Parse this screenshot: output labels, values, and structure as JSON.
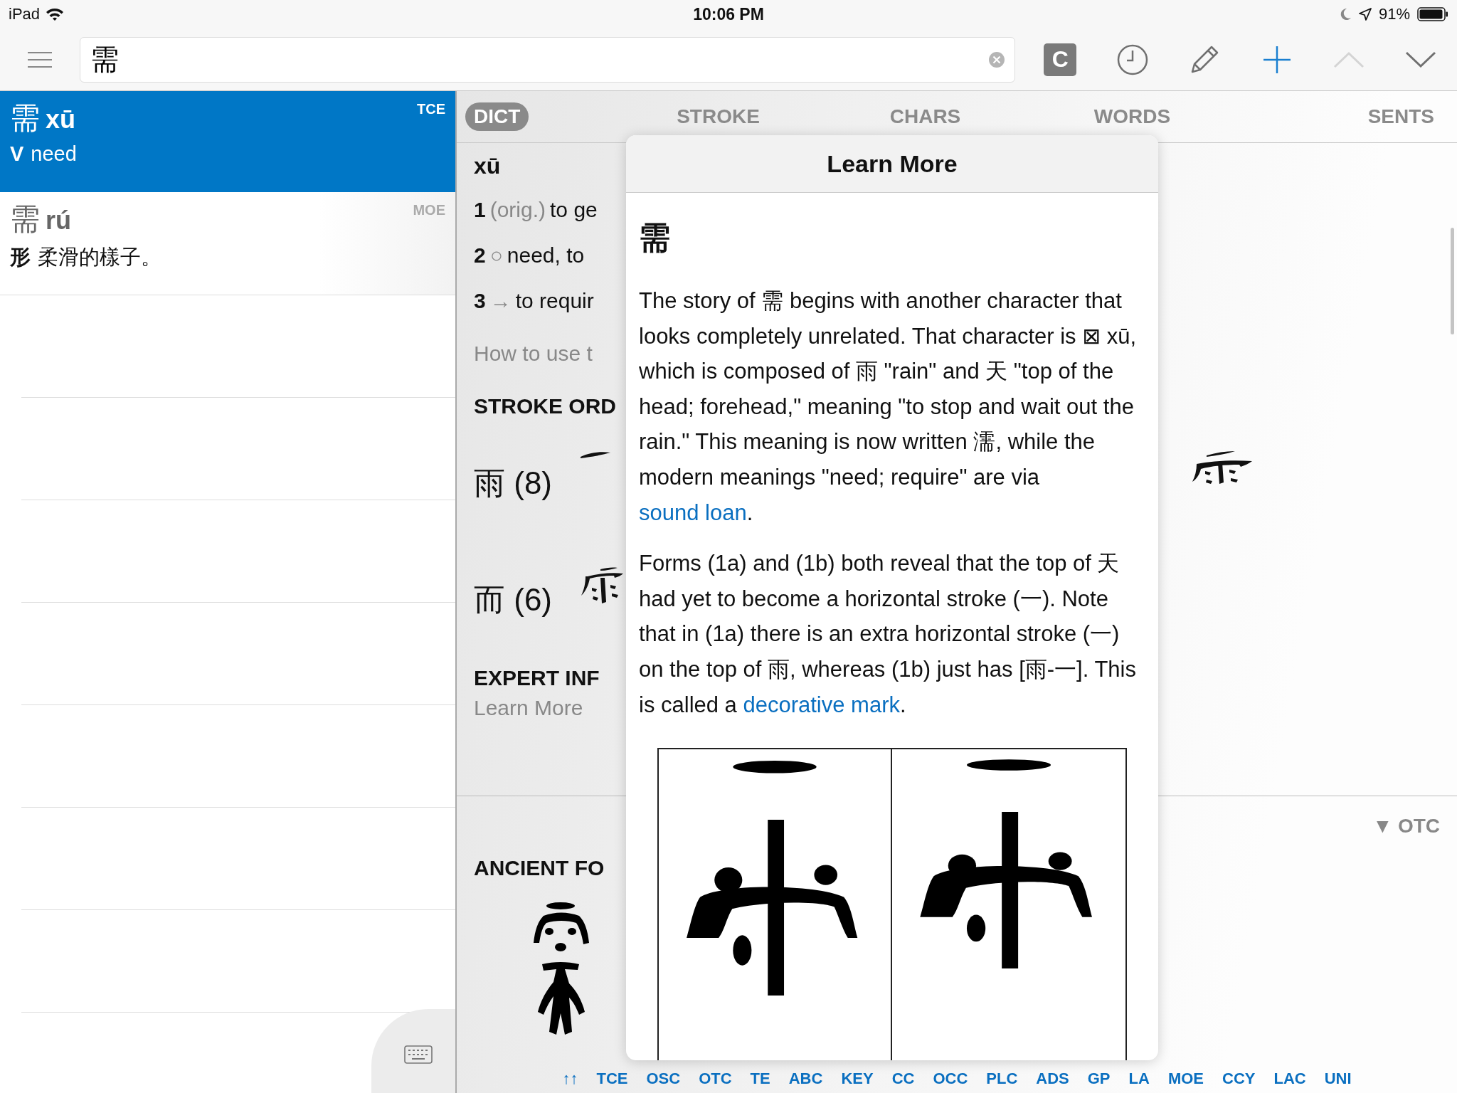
{
  "status_bar": {
    "device": "iPad",
    "time": "10:06 PM",
    "battery": "91%"
  },
  "search": {
    "value": "需"
  },
  "toolbar_buttons": [
    {
      "kind": "clipboard",
      "label": "C",
      "disabled": false
    },
    {
      "kind": "history",
      "disabled": false
    },
    {
      "kind": "edit",
      "disabled": false
    },
    {
      "kind": "add",
      "disabled": false
    },
    {
      "kind": "previous",
      "disabled": true
    },
    {
      "kind": "next",
      "disabled": false
    }
  ],
  "entries": [
    {
      "headword": "需",
      "pinyin": "xū",
      "source": "TCE",
      "pos": "V",
      "gloss": "need",
      "selected": true
    },
    {
      "headword": "需",
      "pinyin": "rú",
      "source": "MOE",
      "pos": "形",
      "gloss": "柔滑的樣子。",
      "selected": false
    }
  ],
  "tabs": [
    {
      "label": "DICT",
      "selected": true
    },
    {
      "label": "STROKE",
      "selected": false
    },
    {
      "label": "CHARS",
      "selected": false
    },
    {
      "label": "WORDS",
      "selected": false
    },
    {
      "label": "SENTS",
      "selected": false
    }
  ],
  "dict": {
    "pinyin": "xū",
    "senses": [
      {
        "number": "1",
        "note": "(orig.)",
        "text": "to ge"
      },
      {
        "number": "2",
        "note": "○",
        "text": "need, to"
      },
      {
        "number": "3",
        "note": "→",
        "text": "to requir"
      }
    ],
    "usage_link": "How to use t",
    "stroke_heading": "STROKE ORD",
    "stroke_rows": [
      {
        "label": "雨 (8)"
      },
      {
        "label": "而 (6)"
      }
    ],
    "expert_heading": "EXPERT INF",
    "expert_link": "Learn More",
    "ancient_heading": "ANCIENT FO",
    "ancient_source": "▼ OTC",
    "source_links": [
      "↑↑",
      "TCE",
      "OSC",
      "OTC",
      "TE",
      "ABC",
      "KEY",
      "CC",
      "OCC",
      "PLC",
      "ADS",
      "GP",
      "LA",
      "MOE",
      "CCY",
      "LAC",
      "UNI"
    ]
  },
  "popover": {
    "title": "Learn More",
    "character": "需",
    "paragraphs": [
      [
        {
          "text": "The story of 需 begins with another character that looks completely unrelated. That character is ⊠ xū, which is composed of 雨 \"rain\" and 天 \"top of the head; forehead,\" meaning \"to stop and wait out the rain.\" This meaning is now written 濡, while the modern meanings \"need; require\" are via "
        },
        {
          "link": "sound loan"
        },
        {
          "text": "."
        }
      ],
      [
        {
          "text": "Forms (1a) and (1b) both reveal that the top of 天 had yet to become a horizontal stroke (一). Note that in (1a) there is an extra horizontal stroke (一) on the top of 雨, whereas (1b) just has [雨-一]. This is called a "
        },
        {
          "link": "decorative mark"
        },
        {
          "text": "."
        }
      ]
    ]
  }
}
